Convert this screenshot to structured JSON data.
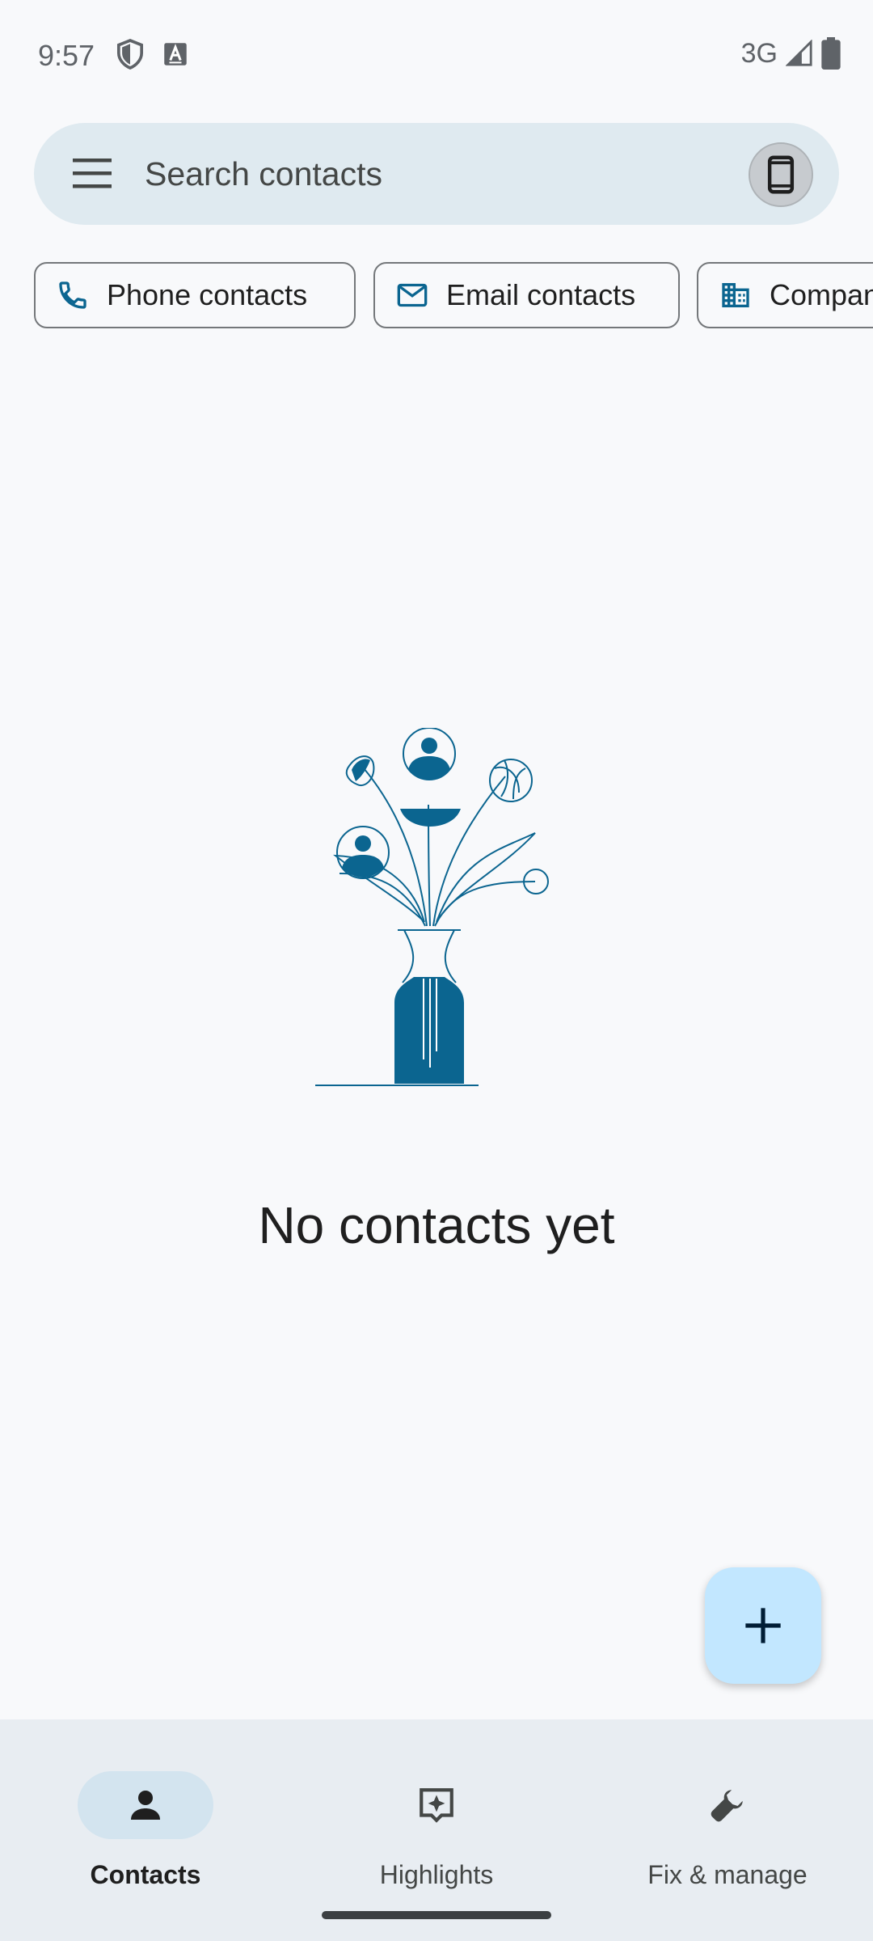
{
  "status_bar": {
    "time": "9:57",
    "network": "3G"
  },
  "search": {
    "placeholder": "Search contacts"
  },
  "chips": [
    {
      "label": "Phone contacts",
      "icon": "phone-icon"
    },
    {
      "label": "Email contacts",
      "icon": "mail-icon"
    },
    {
      "label": "Company",
      "icon": "building-icon"
    }
  ],
  "empty_state": {
    "title": "No contacts yet"
  },
  "bottom_nav": [
    {
      "label": "Contacts",
      "icon": "person-icon",
      "active": true
    },
    {
      "label": "Highlights",
      "icon": "highlights-icon",
      "active": false
    },
    {
      "label": "Fix & manage",
      "icon": "wrench-icon",
      "active": false
    }
  ],
  "colors": {
    "accent": "#0b6590",
    "fab": "#c2e7ff",
    "search_bg": "#dfeaf0",
    "nav_bg": "#e8edf2"
  }
}
